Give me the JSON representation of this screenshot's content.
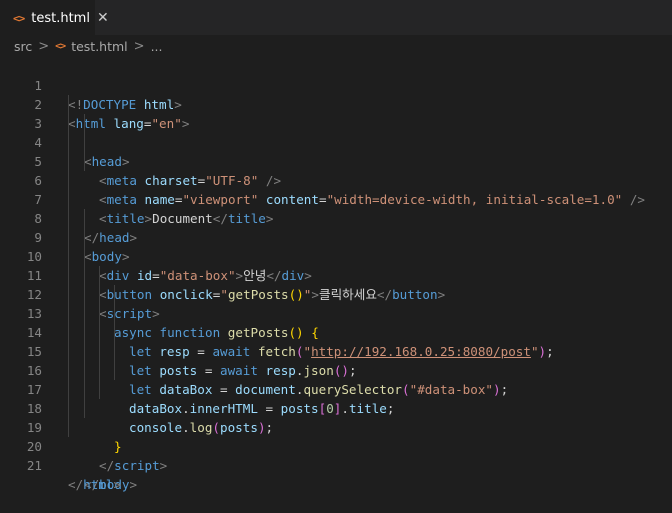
{
  "tab": {
    "icon": "html-file-icon",
    "label": "test.html",
    "close": "✕"
  },
  "breadcrumb": {
    "folder": "src",
    "sep1": ">",
    "icon": "html-file-icon",
    "file": "test.html",
    "sep2": ">",
    "symbol": "..."
  },
  "line_numbers": [
    "1",
    "2",
    "3",
    "4",
    "5",
    "6",
    "7",
    "8",
    "9",
    "10",
    "11",
    "12",
    "13",
    "14",
    "15",
    "16",
    "17",
    "18",
    "19",
    "20",
    "21"
  ],
  "code": {
    "l1": [
      "<!",
      "DOCTYPE",
      " ",
      "html",
      ">"
    ],
    "l2": [
      "<",
      "html",
      " ",
      "lang",
      "=",
      "\"en\"",
      ">"
    ],
    "l3": [
      "<",
      "head",
      ">"
    ],
    "l4": [
      "<",
      "meta",
      " ",
      "charset",
      "=",
      "\"UTF-8\"",
      " />"
    ],
    "l5": [
      "<",
      "meta",
      " ",
      "name",
      "=",
      "\"viewport\"",
      " ",
      "content",
      "=",
      "\"width=device-width, initial-scale=1.0\"",
      " />"
    ],
    "l6": [
      "<",
      "title",
      ">",
      "Document",
      "</",
      "title",
      ">"
    ],
    "l7": [
      "</",
      "head",
      ">"
    ],
    "l8": [
      "<",
      "body",
      ">"
    ],
    "l9": [
      "<",
      "div",
      " ",
      "id",
      "=",
      "\"data-box\"",
      ">",
      "안녕",
      "</",
      "div",
      ">"
    ],
    "l10": [
      "<",
      "button",
      " ",
      "onclick",
      "=",
      "\"",
      "getPosts",
      "()",
      "\"",
      ">",
      "클릭하세요",
      "</",
      "button",
      ">"
    ],
    "l11": [
      "<",
      "script",
      ">"
    ],
    "l12": [
      "async",
      " ",
      "function",
      " ",
      "getPosts",
      "()",
      " ",
      "{"
    ],
    "l13": [
      "let",
      " ",
      "resp",
      " = ",
      "await",
      " ",
      "fetch",
      "(",
      "\"",
      "http://192.168.0.25:8080/post",
      "\"",
      ")",
      ";"
    ],
    "l14": [
      "let",
      " ",
      "posts",
      " = ",
      "await",
      " ",
      "resp",
      ".",
      "json",
      "()",
      ";"
    ],
    "l15": [
      "let",
      " ",
      "dataBox",
      " = ",
      "document",
      ".",
      "querySelector",
      "(",
      "\"#data-box\"",
      ")",
      ";"
    ],
    "l16": [
      "dataBox",
      ".",
      "innerHTML",
      " = ",
      "posts",
      "[",
      "0",
      "]",
      ".",
      "title",
      ";"
    ],
    "l17": [
      "console",
      ".",
      "log",
      "(",
      "posts",
      ")",
      ";"
    ],
    "l18": [
      "}"
    ],
    "l19": [
      "</",
      "script",
      ">"
    ],
    "l20": [
      "</",
      "body",
      ">"
    ],
    "l21": [
      "</",
      "html",
      ">"
    ]
  }
}
